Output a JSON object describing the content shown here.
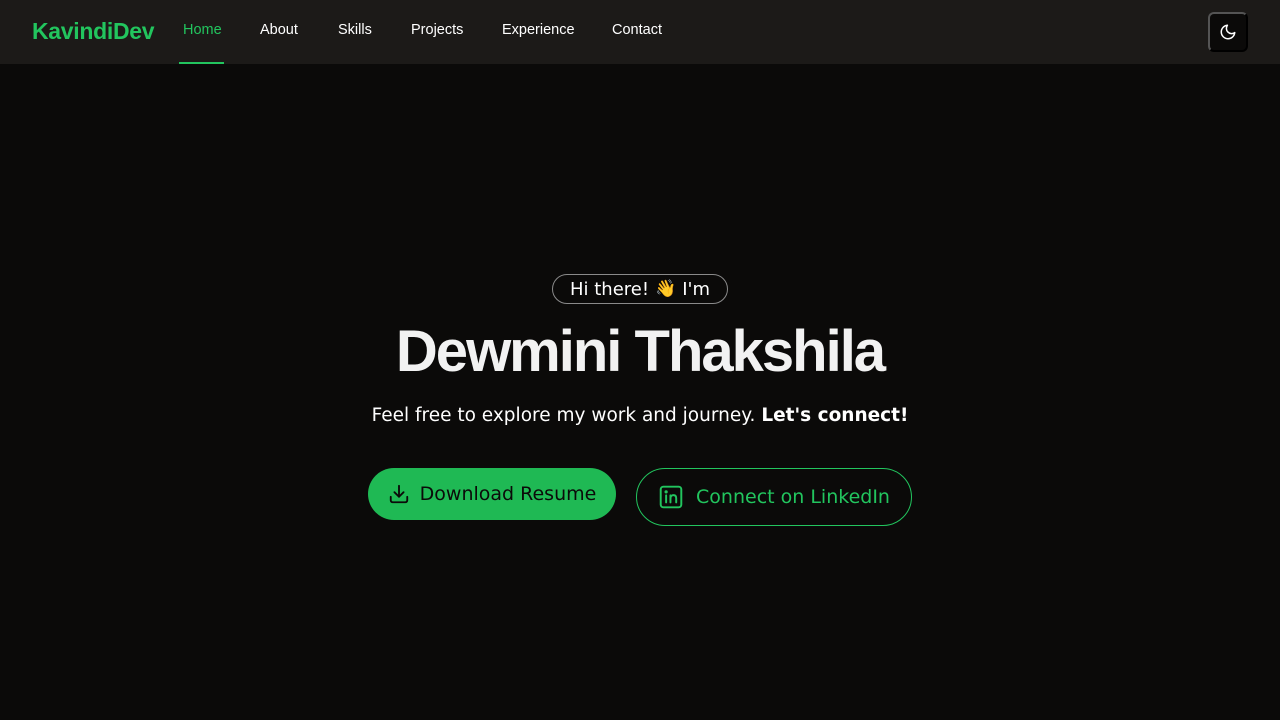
{
  "brand": "KavindiDev",
  "nav": {
    "home": "Home",
    "about": "About",
    "skills": "Skills",
    "projects": "Projects",
    "experience": "Experience",
    "contact": "Contact",
    "active": "Home"
  },
  "theme_toggle_icon": "moon-icon",
  "hero": {
    "greeting_text": "Hi there!",
    "greeting_emoji": "👋",
    "greeting_suffix": "I'm",
    "name": "Dewmini Thakshila",
    "tagline_text": "Feel free to explore my work and journey.",
    "tagline_bold": "Let's connect!"
  },
  "buttons": {
    "resume_label": "Download Resume",
    "resume_icon": "download-icon",
    "linkedin_label": "Connect on LinkedIn",
    "linkedin_icon": "linkedin-icon"
  },
  "colors": {
    "accent": "#22c55e",
    "background": "#0b0a09",
    "navbar": "#1c1a18"
  }
}
